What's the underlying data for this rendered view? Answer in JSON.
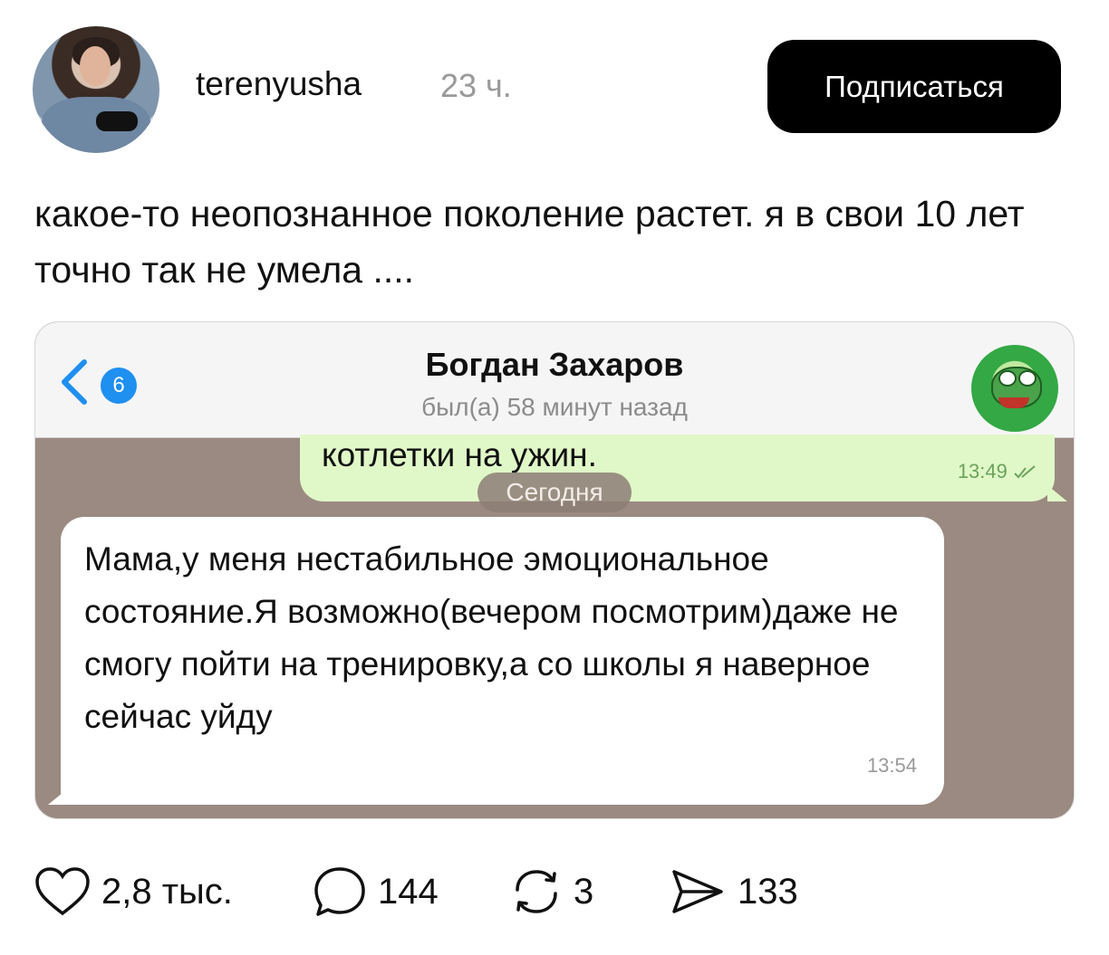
{
  "post": {
    "username": "terenyusha",
    "time": "23 ч.",
    "subscribe_label": "Подписаться",
    "text": "какое-то неопознанное поколение растет. я в свои 10 лет точно так не умела ...."
  },
  "chat": {
    "back_badge": "6",
    "contact_name": "Богдан Захаров",
    "contact_status": "был(а) 58 минут назад",
    "outgoing": {
      "text": "котлетки на ужин.",
      "time": "13:49"
    },
    "date_label": "Сегодня",
    "incoming": {
      "text": "Мама,у меня нестабильное эмоциональное состояние.Я возможно(вечером посмотрим)даже не смогу пойти на тренировку,а со школы я наверное сейчас уйду",
      "time": "13:54"
    }
  },
  "actions": {
    "likes": "2,8 тыс.",
    "comments": "144",
    "reposts": "3",
    "shares": "133"
  },
  "colors": {
    "subscribe_bg": "#000000",
    "outgoing_bubble": "#e0f8c7",
    "chat_background": "#9b8a81",
    "badge": "#1f8ff0"
  },
  "icons": [
    "heart-icon",
    "comment-icon",
    "repost-icon",
    "share-icon",
    "back-chevron-icon",
    "read-checkmarks-icon"
  ]
}
